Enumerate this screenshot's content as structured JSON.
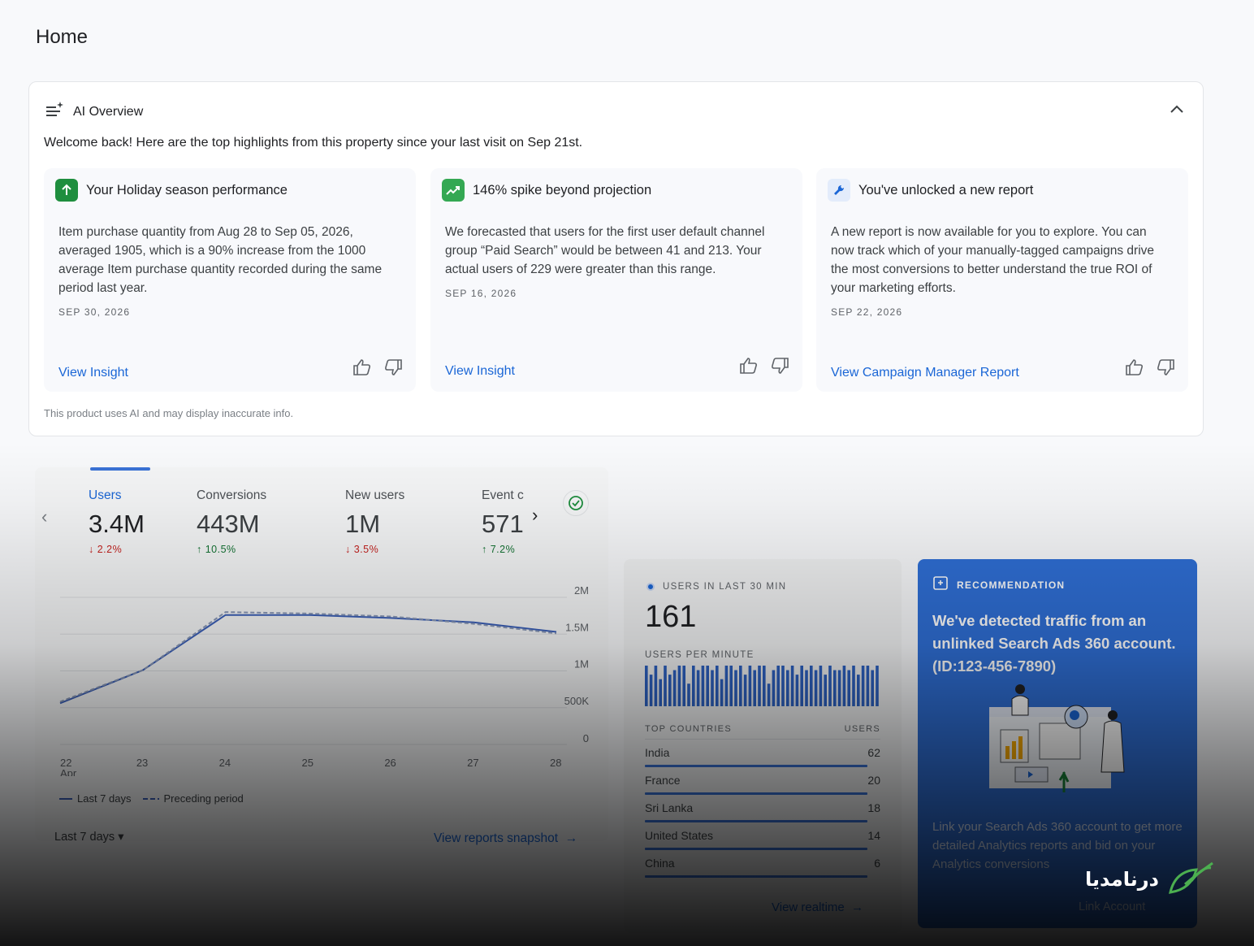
{
  "page": {
    "title": "Home"
  },
  "ai_overview": {
    "label": "AI Overview",
    "welcome": "Welcome back! Here are the top highlights from this property since your last visit on Sep 21st.",
    "disclaimer": "This product uses AI and may display inaccurate info.",
    "insights": [
      {
        "title": "Your Holiday season performance",
        "icon": "arrow-up-icon",
        "icon_color": "#1e8e3e",
        "body": "Item purchase quantity from Aug 28 to Sep 05, 2026, averaged 1905, which is a 90% increase from the 1000 average Item purchase quantity recorded during the same period last year.",
        "date": "SEP 30, 2026",
        "link": "View Insight"
      },
      {
        "title": "146% spike beyond projection",
        "icon": "trending-up-icon",
        "icon_color": "#34a853",
        "body": "We forecasted that users for the first user default channel group “Paid Search” would be between 41 and 213. Your actual users of 229 were greater than this range.",
        "date": "SEP 16, 2026",
        "link": "View Insight"
      },
      {
        "title": "You've unlocked a new report",
        "icon": "wrench-icon",
        "icon_color": "#1a66d6",
        "body": "A new report is now available for you to explore. You can now track which of your manually-tagged campaigns drive the most conversions to better understand the true ROI of your marketing efforts.",
        "date": "SEP 22, 2026",
        "link": "View Campaign Manager Report"
      }
    ]
  },
  "metrics": {
    "items": [
      {
        "label": "Users",
        "value": "3.4M",
        "change": "↓ 2.2%",
        "direction": "down"
      },
      {
        "label": "Conversions",
        "value": "443M",
        "change": "↑ 10.5%",
        "direction": "up"
      },
      {
        "label": "New users",
        "value": "1M",
        "change": "↓ 3.5%",
        "direction": "down"
      },
      {
        "label": "Event c",
        "value": "571",
        "change": "↑ 7.2%",
        "direction": "up"
      }
    ],
    "legend_current": "Last 7 days",
    "legend_previous": "Preceding period",
    "range": "Last 7 days",
    "snapshot_link": "View reports snapshot"
  },
  "chart_data": {
    "type": "line",
    "x": [
      "22",
      "23",
      "24",
      "25",
      "26",
      "27",
      "28"
    ],
    "x_sub": "Apr",
    "y_ticks": [
      "2M",
      "1.5M",
      "1M",
      "500K",
      "0"
    ],
    "ylim": [
      0,
      2000000
    ],
    "series": [
      {
        "name": "Last 7 days",
        "values": [
          560000,
          1010000,
          1760000,
          1760000,
          1720000,
          1660000,
          1530000
        ]
      },
      {
        "name": "Preceding period",
        "values": [
          580000,
          1010000,
          1800000,
          1780000,
          1740000,
          1640000,
          1510000
        ]
      }
    ]
  },
  "realtime": {
    "header": "USERS IN LAST 30 MIN",
    "count": "161",
    "per_minute_label": "USERS PER MINUTE",
    "per_minute": [
      9,
      7,
      9,
      6,
      9,
      7,
      8,
      9,
      9,
      5,
      9,
      8,
      9,
      9,
      8,
      9,
      6,
      9,
      9,
      8,
      9,
      7,
      9,
      8,
      9,
      9,
      5,
      8,
      9,
      9,
      8,
      9,
      7,
      9,
      8,
      9,
      8,
      9,
      7,
      9,
      8,
      8,
      9,
      8,
      9,
      7,
      9,
      9,
      8,
      9
    ],
    "countries_header": "TOP COUNTRIES",
    "users_header": "USERS",
    "countries": [
      {
        "name": "India",
        "users": "62",
        "share": 1.0
      },
      {
        "name": "France",
        "users": "20",
        "share": 1.0
      },
      {
        "name": "Sri Lanka",
        "users": "18",
        "share": 1.0
      },
      {
        "name": "United States",
        "users": "14",
        "share": 1.0
      },
      {
        "name": "China",
        "users": "6",
        "share": 1.0
      }
    ],
    "link": "View realtime"
  },
  "recommendation": {
    "label": "RECOMMENDATION",
    "text": "We've detected traffic from an unlinked Search Ads 360 account. (ID:123-456-7890)",
    "description": "Link your Search Ads 360 account to get more detailed Analytics reports and bid on your Analytics conversions",
    "link": "Link Account"
  },
  "watermark": {
    "text": "درنامدیا"
  },
  "colors": {
    "accent": "#1a66d6",
    "down": "#c5221f",
    "up": "#137333",
    "rec_bg": "#2f6fd6"
  }
}
